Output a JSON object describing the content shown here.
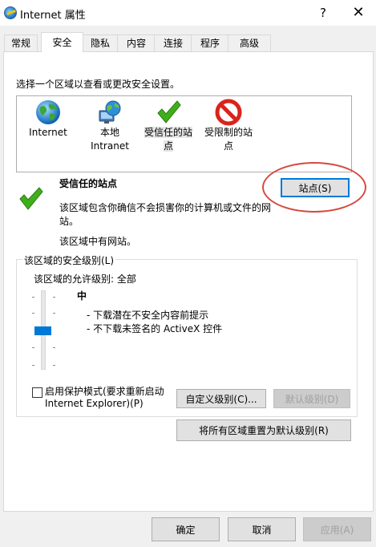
{
  "window": {
    "title": "Internet 属性",
    "help": "?",
    "close": "✕"
  },
  "tabs": [
    "常规",
    "安全",
    "隐私",
    "内容",
    "连接",
    "程序",
    "高级"
  ],
  "security": {
    "select_zone_label": "选择一个区域以查看或更改安全设置。",
    "zones": [
      {
        "icon": "globe-icon",
        "line1": "Internet",
        "line2": ""
      },
      {
        "icon": "local-intranet-icon",
        "line1": "本地",
        "line2": "Intranet"
      },
      {
        "icon": "checkmark-icon",
        "line1": "受信任的站",
        "line2": "点"
      },
      {
        "icon": "restricted-icon",
        "line1": "受限制的站",
        "line2": "点"
      }
    ],
    "selected_zone_index": 2,
    "zone_title": "受信任的站点",
    "zone_desc_line1": "该区域包含你确信不会损害你的计算机或文件的网",
    "zone_desc_line2": "站。",
    "zone_has_sites": "该区域中有网站。",
    "sites_button": "站点(S)",
    "level_group_title": "该区域的安全级别(L)",
    "allowed_levels": "该区域的允许级别: 全部",
    "level_name": "中",
    "level_bullet1": "- 下载潜在不安全内容前提示",
    "level_bullet2": "- 不下载未签名的 ActiveX 控件",
    "slider_level_fraction": 0.5,
    "protected_mode_line1": "启用保护模式(要求重新启动",
    "protected_mode_line2": "Internet Explorer)(P)",
    "protected_mode_checked": false,
    "custom_level_button": "自定义级别(C)...",
    "default_level_button": "默认级别(D)",
    "reset_all_button": "将所有区域重置为默认级别(R)"
  },
  "footer": {
    "ok": "确定",
    "cancel": "取消",
    "apply": "应用(A)"
  },
  "colors": {
    "accent": "#0078d7",
    "annotation": "#d44a3f",
    "check_green": "#3fae1b",
    "restricted_red": "#d9241b"
  }
}
